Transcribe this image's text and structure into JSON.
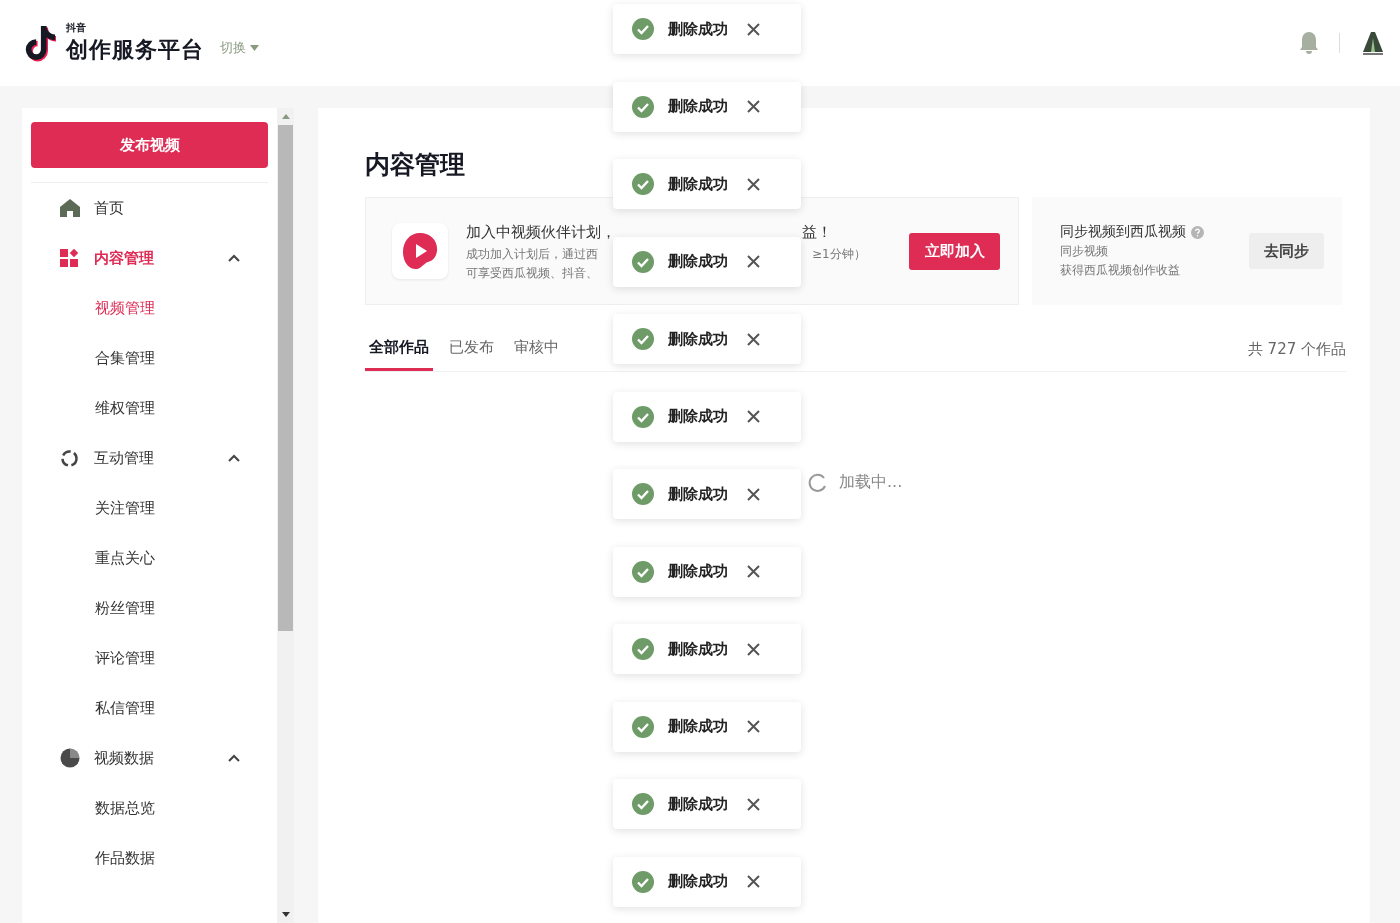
{
  "header": {
    "brand_small": "抖音",
    "brand": "创作服务平台",
    "switch": "切换"
  },
  "sidebar": {
    "publish_button": "发布视频",
    "items": [
      {
        "label": "首页",
        "kind": "link",
        "selected": false
      },
      {
        "label": "内容管理",
        "kind": "group",
        "selected": true,
        "expanded": true,
        "children": [
          {
            "label": "视频管理",
            "selected": true
          },
          {
            "label": "合集管理",
            "selected": false
          },
          {
            "label": "维权管理",
            "selected": false
          }
        ]
      },
      {
        "label": "互动管理",
        "kind": "group",
        "selected": false,
        "expanded": true,
        "children": [
          {
            "label": "关注管理",
            "selected": false
          },
          {
            "label": "重点关心",
            "selected": false
          },
          {
            "label": "粉丝管理",
            "selected": false
          },
          {
            "label": "评论管理",
            "selected": false
          },
          {
            "label": "私信管理",
            "selected": false
          }
        ]
      },
      {
        "label": "视频数据",
        "kind": "group",
        "selected": false,
        "expanded": true,
        "children": [
          {
            "label": "数据总览",
            "selected": false
          },
          {
            "label": "作品数据",
            "selected": false
          }
        ]
      }
    ]
  },
  "page_title": "内容管理",
  "banner": {
    "title": "加入中视频伙伴计划，",
    "title_tail": "益！",
    "description_1": "成功加入计划后，通过西",
    "description_1_tail": "≥1分钟）",
    "description_2": "可享受西瓜视频、抖音、",
    "button": "立即加入"
  },
  "sync_card": {
    "title": "同步视频到西瓜视频",
    "line_1": "同步视频",
    "line_2": "获得西瓜视频创作收益",
    "button": "去同步"
  },
  "tabs": [
    {
      "label": "全部作品",
      "selected": true
    },
    {
      "label": "已发布",
      "selected": false
    },
    {
      "label": "审核中",
      "selected": false
    }
  ],
  "count": "共 727 个作品",
  "loading": "加载中...",
  "toasts": [
    {
      "text": "删除成功"
    },
    {
      "text": "删除成功"
    },
    {
      "text": "删除成功"
    },
    {
      "text": "删除成功"
    },
    {
      "text": "删除成功"
    },
    {
      "text": "删除成功"
    },
    {
      "text": "删除成功"
    },
    {
      "text": "删除成功"
    },
    {
      "text": "删除成功"
    },
    {
      "text": "删除成功"
    },
    {
      "text": "删除成功"
    },
    {
      "text": "删除成功"
    }
  ]
}
